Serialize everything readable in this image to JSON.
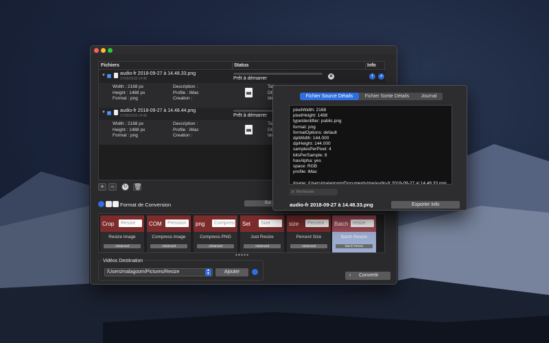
{
  "table": {
    "headers": [
      "Fichiers",
      "Status",
      "Info"
    ],
    "files": [
      {
        "name": "audio-fr 2018-09-27 à 14.48.33.png",
        "date": "27/09/2018 14:48",
        "status": "Prêt à démarrer",
        "details_left": "Width : 2168 px\nHeight : 1488 px\nFormat : png",
        "details_mid": "Description :\nProfile : iMac\nCreation :",
        "details_right": "Tail\nDPI\nIde"
      },
      {
        "name": "audio-fr 2018-09-27 à 14.48.44.png",
        "date": "27/09/2018 14:48",
        "status": "Prêt à démarrer",
        "details_left": "Width : 2168 px\nHeight : 1488 px\nFormat : png",
        "details_mid": "Description :\nProfile : iMac\nCreation :",
        "details_right": "Tail\nDPI\nIde"
      }
    ]
  },
  "toolbar": {
    "add": "+",
    "remove": "−"
  },
  "format": {
    "label": "Format de Conversion",
    "bat_button": "Bat"
  },
  "presets": [
    {
      "tag": "Crop",
      "field": "Resize",
      "caption": "Resize image",
      "advanced": "Advanced",
      "color": "#7d2c2c"
    },
    {
      "tag": "COM",
      "field": "Pression",
      "caption": "Compress image",
      "advanced": "Advanced",
      "color": "#7d2c2c"
    },
    {
      "tag": "png",
      "field": "Compress",
      "caption": "Compress PNG",
      "advanced": "Advanced",
      "color": "#7d2c2c"
    },
    {
      "tag": "Set",
      "field": "Size",
      "caption": "Just Resize",
      "advanced": "Advanced",
      "color": "#7d2c2c"
    },
    {
      "tag": "size",
      "field": "Percent",
      "caption": "Percent Size",
      "advanced": "Advanced",
      "color": "#7d2c2c"
    },
    {
      "tag": "Batch",
      "field": "resize",
      "caption": "Batch Resize",
      "advanced": "Batch Resize",
      "color": "#a04a58"
    }
  ],
  "pager_dots": "●●●●●",
  "destination": {
    "label": "Vidéos Destination",
    "path": "/Users/malagoom/Pictures/Resize",
    "add_button": "Ajouter"
  },
  "convert_button": "Convertir",
  "info_panel": {
    "tabs": [
      "Fichier Source Détails",
      "Fichier Sortie Détails",
      "Journal"
    ],
    "text": "pixelWidth: 2168\npixelHeight: 1488\ntypeIdentifier: public.png\nformat: png\nformatOptions: default\ndpiWidth: 144.000\ndpiHeight: 144.000\nsamplesPerPixel: 4\nbitsPerSample: 8\nhasAlpha: yes\nspace: RGB\nprofile: iMac\n\nImage: /Users/malagoom/Documents/me/audio-fr 2018-09-27 al 14.48.33.png\n Format: PNG (Portable Network Graphics)",
    "search_placeholder": "Rechercher",
    "filename": "audio-fr 2018-09-27 à 14.48.33.png",
    "export_button": "Exporter Info"
  },
  "colors": {
    "accent": "#2f6ee0",
    "preset": "#7d2c2c",
    "selected_card": "#9dadd1"
  }
}
